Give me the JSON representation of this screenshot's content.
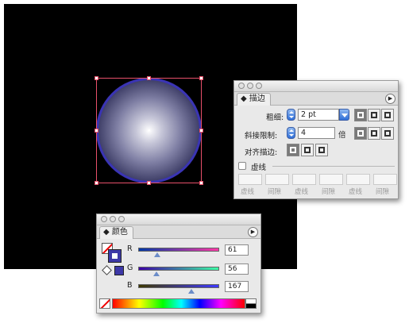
{
  "stroke_panel": {
    "tab_label": "描边",
    "weight_label": "粗细:",
    "weight_value": "2 pt",
    "miter_label": "斜接限制:",
    "miter_value": "4",
    "miter_unit": "倍",
    "align_label": "对齐描边:",
    "dashed_label": "虚线",
    "dash_labels": [
      "虚线",
      "间隙",
      "虚线",
      "间隙",
      "虚线",
      "间隙"
    ]
  },
  "color_panel": {
    "tab_label": "颜色",
    "channels": [
      {
        "name": "R",
        "value": "61",
        "level": 61
      },
      {
        "name": "G",
        "value": "56",
        "level": 56
      },
      {
        "name": "B",
        "value": "167",
        "level": 167
      }
    ],
    "fill_color": "#3d38a7",
    "stroke_color": "#3d38a7"
  },
  "colors": {
    "selection": "#e8506a",
    "circle_stroke": "#3a34b4"
  }
}
